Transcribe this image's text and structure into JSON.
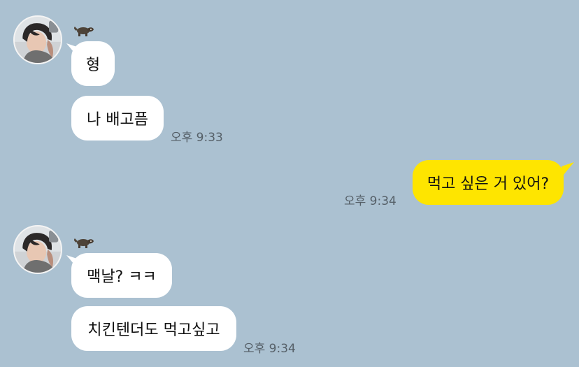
{
  "chat": {
    "background_color": "#abc1d1",
    "groups": [
      {
        "sender": {
          "avatar": "profile-photo-avatar",
          "name_icon": "raccoon-icon"
        },
        "messages": [
          {
            "text": "형",
            "time": ""
          },
          {
            "text": "나 배고픔",
            "time": "오후 9:33"
          }
        ]
      },
      {
        "outgoing": true,
        "messages": [
          {
            "text": "먹고 싶은 거 있어?",
            "time": "오후 9:34"
          }
        ]
      },
      {
        "sender": {
          "avatar": "profile-photo-avatar",
          "name_icon": "raccoon-icon"
        },
        "messages": [
          {
            "text": "맥날? ㅋㅋ",
            "time": ""
          },
          {
            "text": "치킨텐더도 먹고싶고",
            "time": "오후 9:34"
          }
        ]
      }
    ],
    "colors": {
      "incoming_bubble": "#ffffff",
      "outgoing_bubble": "#fee500",
      "timestamp": "#555f67"
    }
  }
}
